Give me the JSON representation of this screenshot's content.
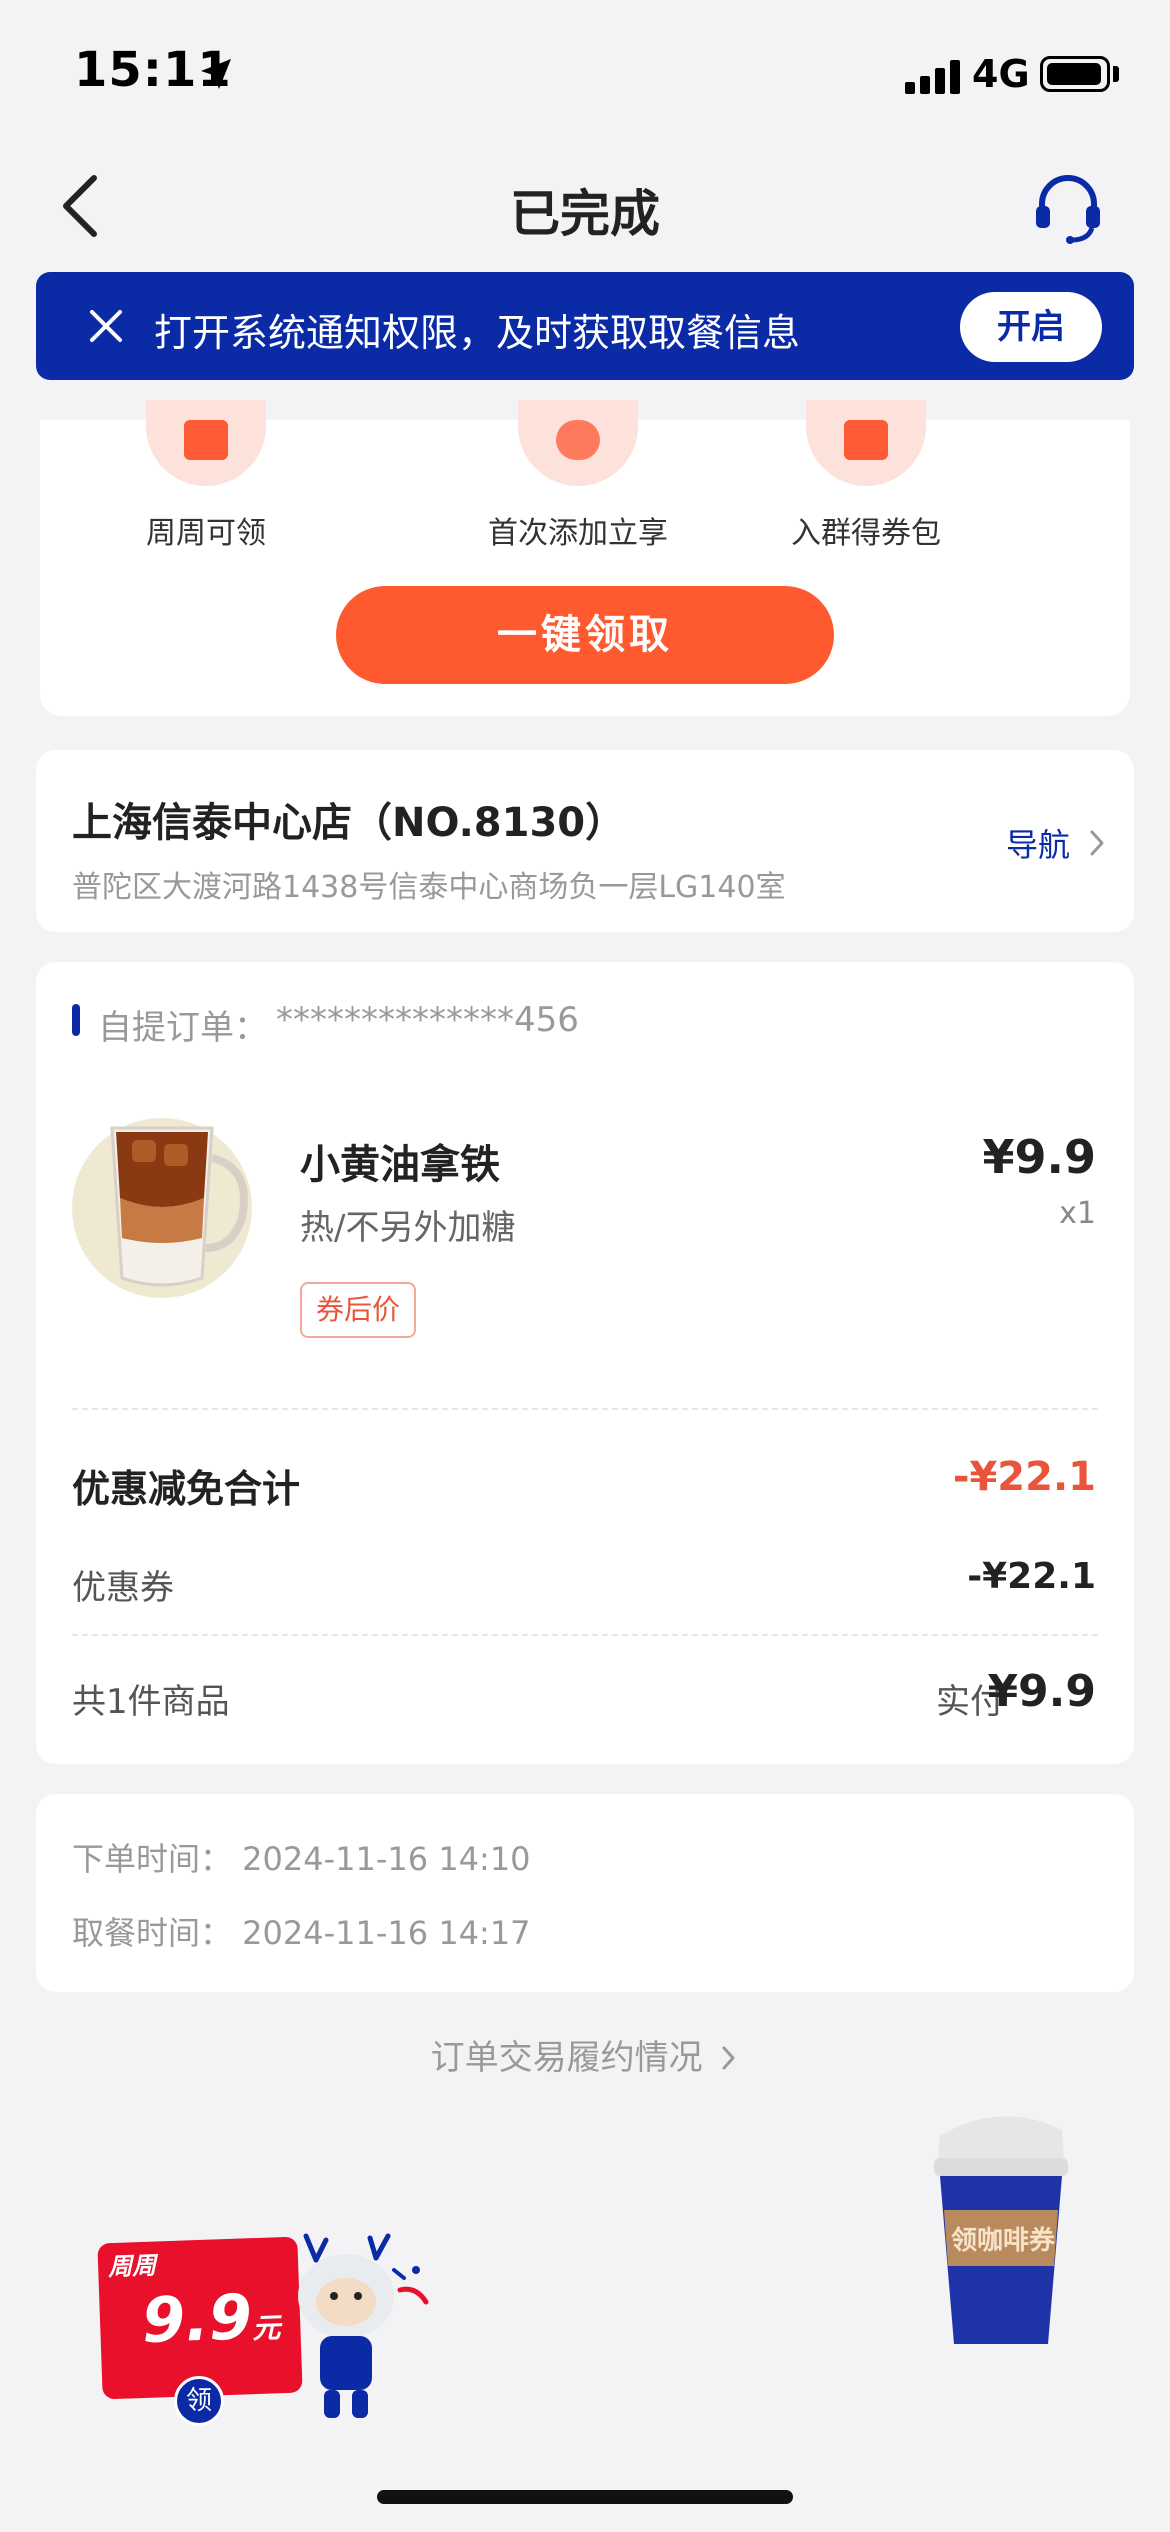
{
  "status_bar": {
    "time": "15:11",
    "network": "4G"
  },
  "header": {
    "title": "已完成"
  },
  "notification": {
    "text": "打开系统通知权限，及时获取取餐信息",
    "action": "开启"
  },
  "benefits": {
    "items": [
      {
        "label": "周周可领"
      },
      {
        "label": "首次添加立享"
      },
      {
        "label": "入群得券包"
      }
    ],
    "claim_button": "一键领取"
  },
  "store": {
    "name": "上海信泰中心店（NO.8130）",
    "address": "普陀区大渡河路1438号信泰中心商场负一层LG140室",
    "nav_label": "导航"
  },
  "order": {
    "type_label": "自提订单：",
    "number": "**************456",
    "product": {
      "name": "小黄油拿铁",
      "spec": "热/不另外加糖",
      "tag": "券后价",
      "price": "¥9.9",
      "quantity": "x1"
    },
    "discount_total_label": "优惠减免合计",
    "discount_total_value": "-¥22.1",
    "coupon_label": "优惠券",
    "coupon_value": "-¥22.1",
    "item_count_label": "共1件商品",
    "paid_label": "实付",
    "paid_value": "¥9.9"
  },
  "times": {
    "order_time": "下单时间：  2024-11-16 14:10",
    "pickup_time": "取餐时间：  2024-11-16 14:17"
  },
  "trade_link": "订单交易履约情况",
  "promo": {
    "week_label": "周周",
    "amount": "9.9",
    "unit": "元",
    "take": "领"
  },
  "coffee_coupon": {
    "label": "领咖啡券"
  },
  "colors": {
    "brand_blue": "#0b2aa6",
    "accent_orange": "#ff5a2f",
    "discount_red": "#e8553a"
  }
}
